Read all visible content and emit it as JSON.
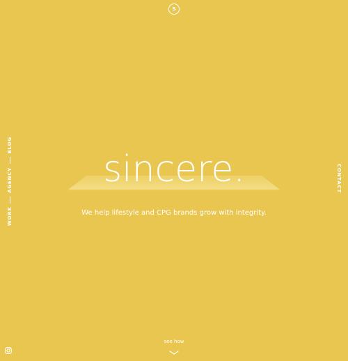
{
  "brand": {
    "logo_letter": "s",
    "logo_icon": "sincere-logo-icon"
  },
  "nav": {
    "left_items": [
      "WORK",
      "AGENCY",
      "BLOG"
    ],
    "right_items": [
      "CONTACT"
    ]
  },
  "hero": {
    "headline": "sincere.",
    "tagline": "We help lifestyle and CPG brands grow with integrity."
  },
  "footer": {
    "see_how_label": "see how",
    "scroll_icon": "chevron-down-icon",
    "social_icon": "instagram-icon"
  },
  "colors": {
    "background": "#E8C64F",
    "text": "#FFFFFF"
  }
}
